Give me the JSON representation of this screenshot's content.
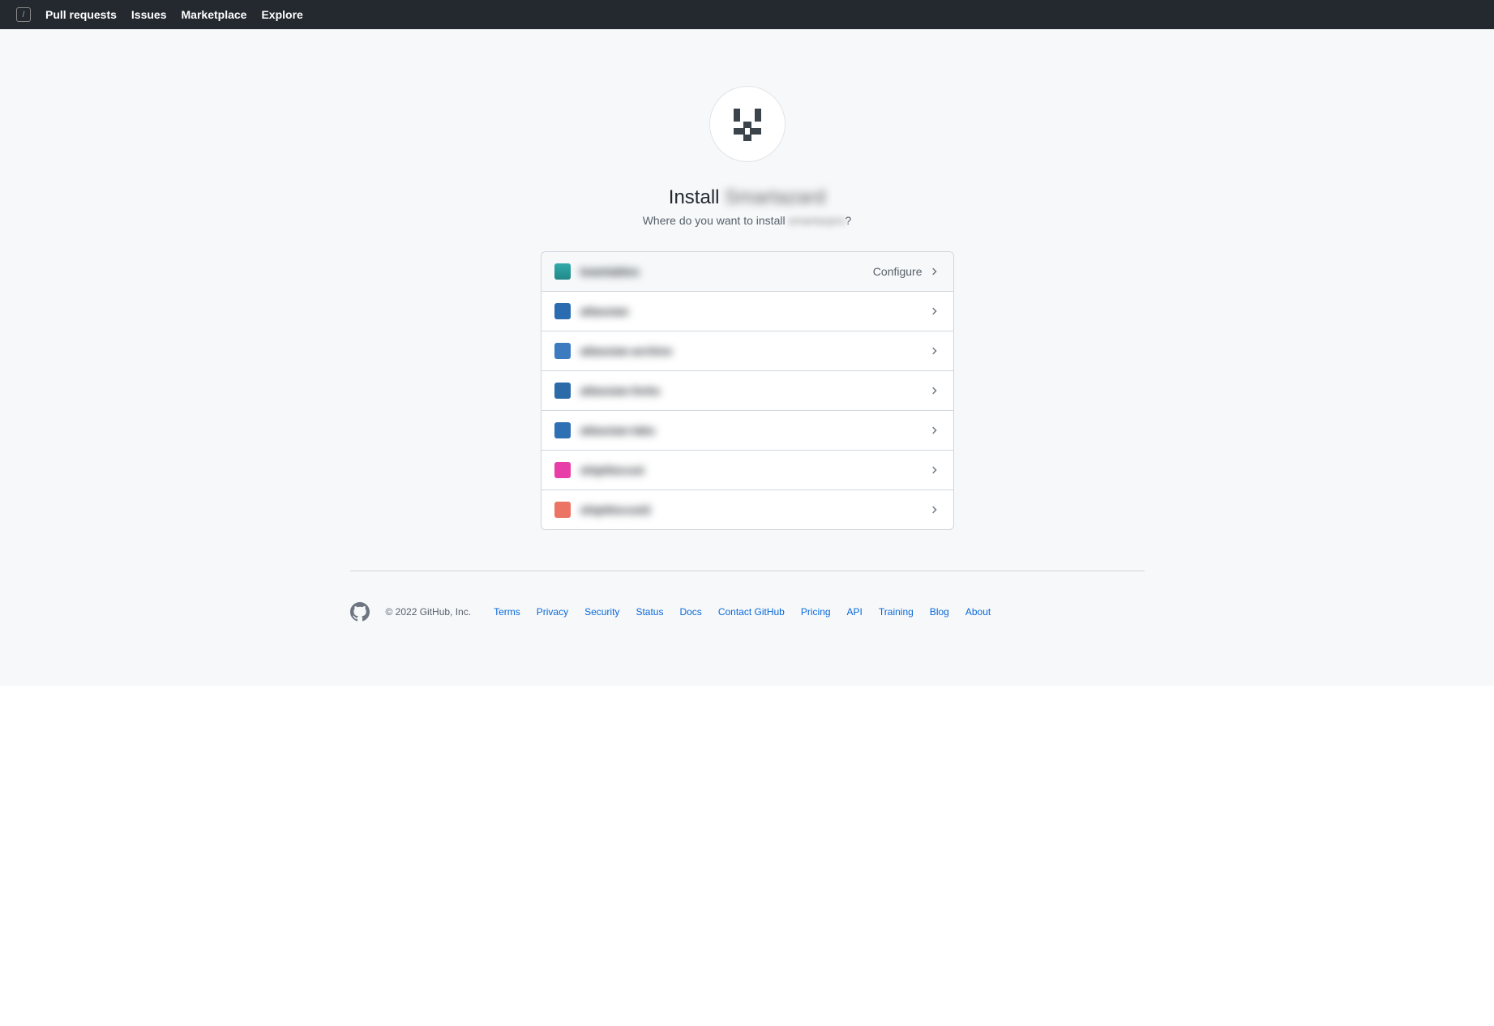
{
  "nav": {
    "items": [
      "Pull requests",
      "Issues",
      "Marketplace",
      "Explore"
    ]
  },
  "install": {
    "title_prefix": "Install ",
    "app_name": "Smartazard",
    "sub_prefix": "Where do you want to install ",
    "sub_app": "smartazpro",
    "sub_suffix": "?"
  },
  "orgs": [
    {
      "name": "teamtables",
      "configured": true,
      "configure_label": "Configure",
      "avatar": "av-teal"
    },
    {
      "name": "atlassian",
      "configured": false,
      "avatar": "av-blue"
    },
    {
      "name": "atlassian-archive",
      "configured": false,
      "avatar": "av-blue2"
    },
    {
      "name": "atlassian-forks",
      "configured": false,
      "avatar": "av-blue3"
    },
    {
      "name": "atlassian-labs",
      "configured": false,
      "avatar": "av-blue4"
    },
    {
      "name": "shipittocust",
      "configured": false,
      "avatar": "av-pink"
    },
    {
      "name": "shipittocust2",
      "configured": false,
      "avatar": "av-red"
    }
  ],
  "footer": {
    "copyright": "© 2022 GitHub, Inc.",
    "links": [
      "Terms",
      "Privacy",
      "Security",
      "Status",
      "Docs",
      "Contact GitHub",
      "Pricing",
      "API",
      "Training",
      "Blog",
      "About"
    ]
  }
}
